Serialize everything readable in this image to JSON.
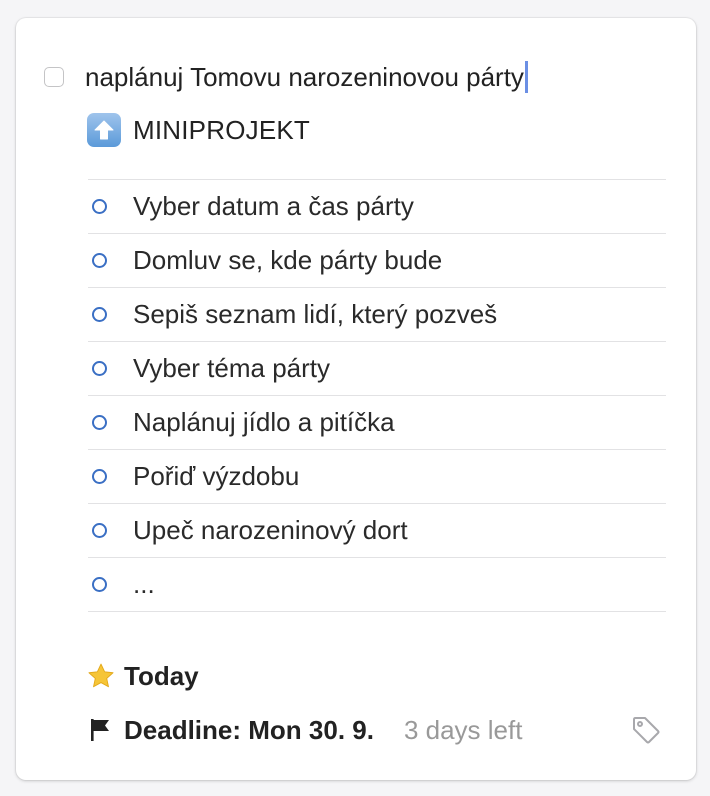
{
  "task": {
    "title": "naplánuj Tomovu narozeninovou párty",
    "heading_icon": "arrow-up-icon",
    "heading": "MINIPROJEKT",
    "checklist": [
      "Vyber datum a čas párty",
      "Domluv se, kde párty bude",
      "Sepiš seznam lidí, který pozveš",
      "Vyber téma párty",
      "Naplánuj jídlo a pitíčka",
      "Pořiď výzdobu",
      "Upeč narozeninový dort",
      "..."
    ],
    "when": {
      "icon": "star-icon",
      "label": "Today"
    },
    "deadline": {
      "icon": "flag-icon",
      "label": "Deadline: Mon 30. 9.",
      "remaining": "3 days left"
    },
    "tags_icon": "tag-icon"
  },
  "colors": {
    "accent_blue": "#3a6fc4",
    "caret": "#6b8fe4",
    "star": "#f6c537",
    "muted_text": "#999999"
  }
}
